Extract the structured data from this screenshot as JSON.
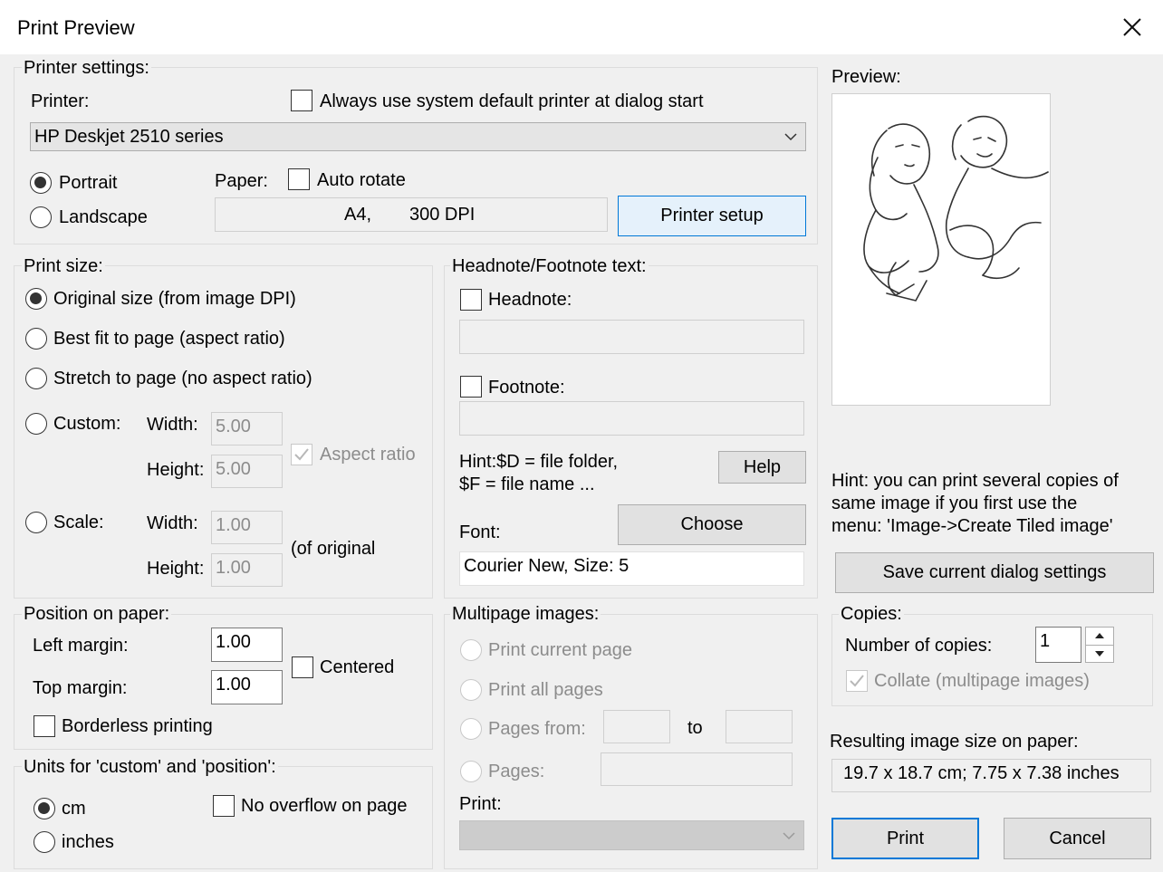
{
  "window": {
    "title": "Print Preview"
  },
  "printer_settings": {
    "legend": "Printer settings:",
    "printer_label": "Printer:",
    "always_default_label": "Always use system default printer at dialog start",
    "printer_value": "HP Deskjet 2510 series",
    "portrait_label": "Portrait",
    "landscape_label": "Landscape",
    "paper_label": "Paper:",
    "auto_rotate_label": "Auto rotate",
    "paper_size": "A4,",
    "paper_dpi": "300 DPI",
    "printer_setup_label": "Printer setup"
  },
  "print_size": {
    "legend": "Print size:",
    "original_label": "Original size (from image DPI)",
    "best_fit_label": "Best fit to page (aspect ratio)",
    "stretch_label": "Stretch to page (no aspect ratio)",
    "custom_label": "Custom:",
    "width_label": "Width:",
    "height_label": "Height:",
    "custom_width": "5.00",
    "custom_height": "5.00",
    "aspect_ratio_label": "Aspect ratio",
    "scale_label": "Scale:",
    "scale_width": "1.00",
    "scale_height": "1.00",
    "of_original_label": "(of original"
  },
  "headnote": {
    "legend": "Headnote/Footnote text:",
    "headnote_label": "Headnote:",
    "footnote_label": "Footnote:",
    "hint_line1": "Hint:$D = file folder,",
    "hint_line2": "$F = file name ...",
    "help_label": "Help",
    "font_label": "Font:",
    "choose_label": "Choose",
    "font_value": "Courier New, Size: 5"
  },
  "preview": {
    "label": "Preview:",
    "hint_line1": "Hint: you can print several copies of",
    "hint_line2": "same image if you first use the",
    "hint_line3": "menu: 'Image->Create Tiled image'",
    "save_label": "Save current dialog settings"
  },
  "position": {
    "legend": "Position on paper:",
    "left_margin_label": "Left margin:",
    "left_margin": "1.00",
    "top_margin_label": "Top margin:",
    "top_margin": "1.00",
    "centered_label": "Centered",
    "borderless_label": "Borderless printing"
  },
  "units": {
    "legend": "Units for 'custom' and 'position':",
    "cm_label": "cm",
    "inches_label": "inches",
    "no_overflow_label": "No overflow on page"
  },
  "multipage": {
    "legend": "Multipage images:",
    "current_label": "Print current page",
    "all_label": "Print all pages",
    "from_label": "Pages from:",
    "to_label": "to",
    "pages_label": "Pages:",
    "print_label": "Print:"
  },
  "copies": {
    "legend": "Copies:",
    "number_label": "Number of copies:",
    "number_value": "1",
    "collate_label": "Collate (multipage images)"
  },
  "result": {
    "label": "Resulting image size on paper:",
    "value": "19.7 x 18.7 cm; 7.75 x 7.38 inches"
  },
  "actions": {
    "print_label": "Print",
    "cancel_label": "Cancel"
  },
  "colors": {
    "accent": "#0078d7",
    "disabled_text": "#8c8c8c"
  }
}
